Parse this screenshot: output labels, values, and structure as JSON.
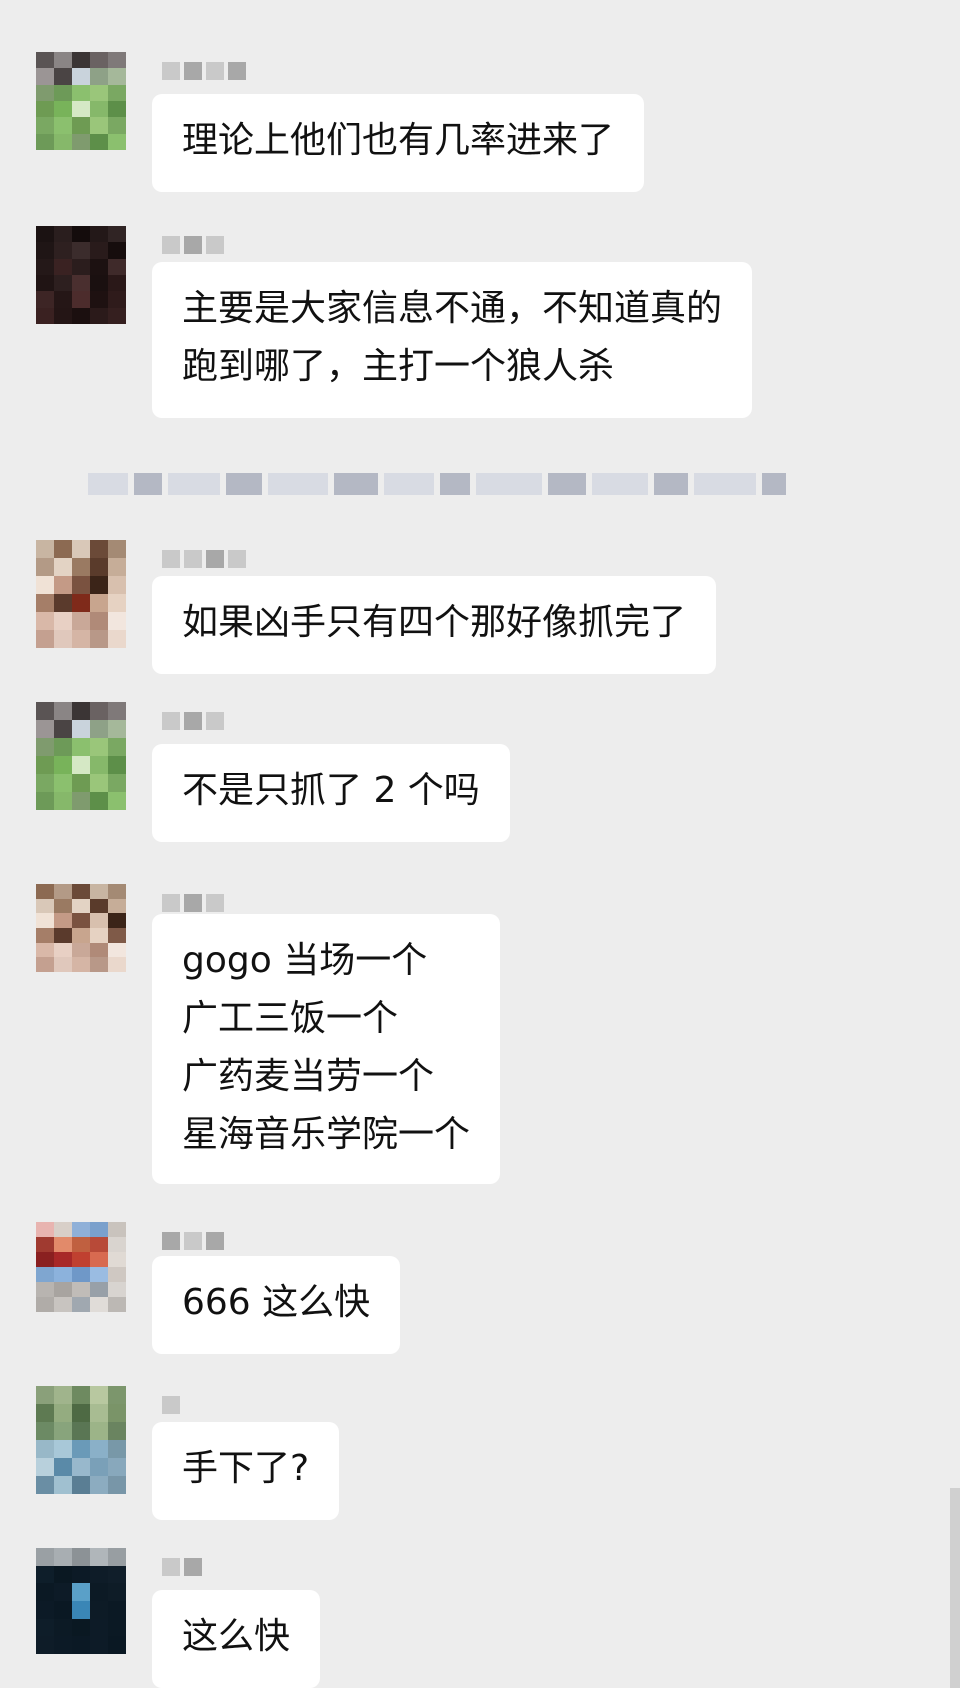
{
  "messages": [
    {
      "id": 1,
      "text": "理论上他们也有几率进来了",
      "avatar_colors": [
        "#5a5454",
        "#8a8585",
        "#3b3535",
        "#6a6262",
        "#7f7979",
        "#9b9595",
        "#4a4444",
        "#c9d3dc",
        "#8ea187",
        "#a5b89a",
        "#7f9b6e",
        "#6d9a58",
        "#8bc06e",
        "#9ac67a",
        "#7aa862",
        "#6e9b53",
        "#78b35a",
        "#d5e8c5",
        "#86b86a",
        "#5d8f49",
        "#7aa862",
        "#8bc06e",
        "#6e9b53",
        "#9ac67a",
        "#7aa862",
        "#6d9a58",
        "#86b86a",
        "#7f9b6e",
        "#5d8f49",
        "#8bc06e"
      ]
    },
    {
      "id": 2,
      "text": "主要是大家信息不通，不知道真的\n跑到哪了，主打一个狼人杀",
      "avatar_colors": [
        "#1b1212",
        "#2a1e1e",
        "#140c0c",
        "#231818",
        "#302424",
        "#1f1515",
        "#2e2020",
        "#3b2c2c",
        "#291b1b",
        "#160d0d",
        "#241818",
        "#3a2222",
        "#2b1d1d",
        "#1c1111",
        "#3f2a2a",
        "#201414",
        "#2d1f1f",
        "#4a2f2f",
        "#1a1010",
        "#2a1818",
        "#3d2525",
        "#251616",
        "#4c2c2c",
        "#1e1111",
        "#2f1b1b",
        "#3a2121",
        "#241515",
        "#1b0f0f",
        "#2b1a1a",
        "#351f1f"
      ]
    },
    {
      "id": 3,
      "text": "如果凶手只有四个那好像抓完了",
      "avatar_colors": [
        "#c8b5a2",
        "#8c6a52",
        "#d9c8b8",
        "#6b4a38",
        "#a48a74",
        "#b39a86",
        "#e3d3c4",
        "#9a7a62",
        "#5a3b2b",
        "#c6ad98",
        "#f0e2d6",
        "#c49a86",
        "#7a5240",
        "#3b2418",
        "#d8c0ae",
        "#a57e68",
        "#5a3a2c",
        "#7f2a1a",
        "#c8a58e",
        "#e6d2c2",
        "#d9b8a8",
        "#e8d0c4",
        "#c9a898",
        "#b08a78",
        "#f2e6de",
        "#c4a090",
        "#e0c8bc",
        "#d5b5a5",
        "#b89888",
        "#ead8cc"
      ]
    },
    {
      "id": 4,
      "text": "不是只抓了 2 个吗",
      "avatar_colors": [
        "#5a5454",
        "#8a8585",
        "#3b3535",
        "#6a6262",
        "#7f7979",
        "#9b9595",
        "#4a4444",
        "#c9d3dc",
        "#8ea187",
        "#a5b89a",
        "#7f9b6e",
        "#6d9a58",
        "#8bc06e",
        "#9ac67a",
        "#7aa862",
        "#6e9b53",
        "#78b35a",
        "#d5e8c5",
        "#86b86a",
        "#5d8f49",
        "#7aa862",
        "#8bc06e",
        "#6e9b53",
        "#9ac67a",
        "#7aa862",
        "#6d9a58",
        "#86b86a",
        "#7f9b6e",
        "#5d8f49",
        "#8bc06e"
      ]
    },
    {
      "id": 5,
      "text": "gogo 当场一个\n广工三饭一个\n广药麦当劳一个\n星海音乐学院一个",
      "avatar_colors": [
        "#8c6a52",
        "#b39a86",
        "#6b4a38",
        "#c8b5a2",
        "#a48a74",
        "#d9c8b8",
        "#9a7a62",
        "#e3d3c4",
        "#5a3b2b",
        "#c6ad98",
        "#f0e2d6",
        "#c49a86",
        "#7a5240",
        "#d8c0ae",
        "#3b2418",
        "#a57e68",
        "#5a3a2c",
        "#c8a58e",
        "#e6d2c2",
        "#7f5a48",
        "#d9b8a8",
        "#e8d0c4",
        "#c9a898",
        "#b08a78",
        "#f2e6de",
        "#c4a090",
        "#e0c8bc",
        "#d5b5a5",
        "#b89888",
        "#ead8cc"
      ]
    },
    {
      "id": 6,
      "text": "666 这么快",
      "avatar_colors": [
        "#e8b4b0",
        "#d8cfc8",
        "#8fb0d8",
        "#7aa0cc",
        "#c9c3bd",
        "#a03a30",
        "#e28a6a",
        "#c06040",
        "#b84a38",
        "#d9d4cf",
        "#8a2020",
        "#a82828",
        "#c04030",
        "#d86a50",
        "#e0dad4",
        "#7fa6d0",
        "#8cb2dc",
        "#6f98c8",
        "#9abce2",
        "#cfc8c2",
        "#b8b4b0",
        "#a8a4a0",
        "#c0bcb8",
        "#98a0a8",
        "#d8d4d0",
        "#b0aca8",
        "#c8c4c0",
        "#a0a8b0",
        "#e0dcd8",
        "#bcb8b4"
      ]
    },
    {
      "id": 7,
      "text": "手下了?",
      "avatar_colors": [
        "#8aa07a",
        "#a0b48c",
        "#6e8a60",
        "#b8c8a0",
        "#7c966c",
        "#5e7a52",
        "#94ac80",
        "#4e6a44",
        "#a8bc92",
        "#7a9468",
        "#6c8a64",
        "#88a47c",
        "#5a7654",
        "#9cb488",
        "#6a8460",
        "#98b8c8",
        "#a8c8d8",
        "#6a9ab8",
        "#8ab0c8",
        "#7898a8",
        "#b8d0dc",
        "#5a8aa8",
        "#98b8cc",
        "#7aa0b8",
        "#88a8bc",
        "#6a8ea4",
        "#a0c0d0",
        "#5a7e94",
        "#8cacc0",
        "#7896a8"
      ]
    },
    {
      "id": 8,
      "text": "这么快",
      "avatar_colors": [
        "#9aa0a4",
        "#a8aeb2",
        "#8c9296",
        "#b0b6ba",
        "#989ea2",
        "#0e1e2a",
        "#0a1822",
        "#0c1a26",
        "#0e1c28",
        "#101e2a",
        "#0b1924",
        "#0d1b27",
        "#5aa0c8",
        "#0c1a25",
        "#0e1c27",
        "#0c1a26",
        "#0a1823",
        "#3a86b6",
        "#0d1b26",
        "#0b1924",
        "#0e1d29",
        "#0c1a25",
        "#0a1822",
        "#0d1b27",
        "#0b1924",
        "#0e1c28",
        "#0c1a26",
        "#0b1925",
        "#0d1b27",
        "#0a1823"
      ]
    }
  ]
}
